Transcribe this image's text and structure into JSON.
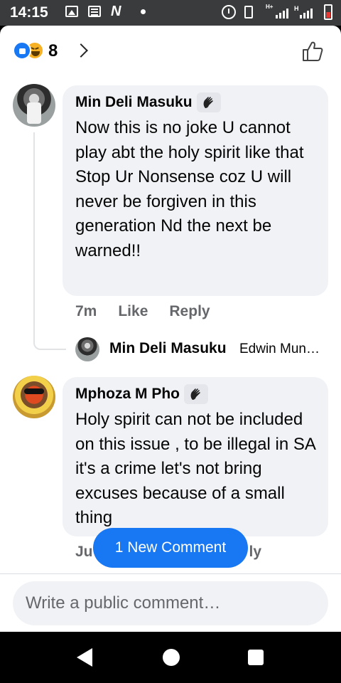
{
  "status_bar": {
    "time": "14:15",
    "icons": [
      "gallery-icon",
      "news-icon",
      "n-app-icon",
      "notification-dot-icon",
      "alarm-icon",
      "vibrate-icon",
      "signal-icon",
      "signal-icon",
      "battery-low-icon"
    ],
    "network_labels": [
      "H+",
      "H"
    ]
  },
  "reactions": {
    "types": [
      "like",
      "haha"
    ],
    "count": "8"
  },
  "comments": [
    {
      "author": "Min Deli Masuku",
      "badge": "wave-hand-icon",
      "text": "Now this is no joke U cannot play abt the holy spirit like that\nStop Ur Nonsense coz U will never be forgiven in this generation Nd the next be warned!!",
      "time": "7m",
      "like_label": "Like",
      "reply_label": "Reply",
      "reply_preview": {
        "author": "Min Deli Masuku",
        "text": "Edwin Mun…"
      }
    },
    {
      "author": "Mphoza M Pho",
      "badge": "wave-hand-icon",
      "text": "Holy spirit can not be included on this issue , to be illegal in SA it's a crime let's not bring excuses because of a small thing",
      "time_partial": "Ju",
      "reply_partial": "ly"
    }
  ],
  "new_comment_pill": "1 New Comment",
  "composer": {
    "placeholder": "Write a public comment…"
  },
  "colors": {
    "accent": "#1877f2",
    "bubble": "#f0f2f5",
    "meta_text": "#65676b",
    "primary_text": "#050505"
  }
}
